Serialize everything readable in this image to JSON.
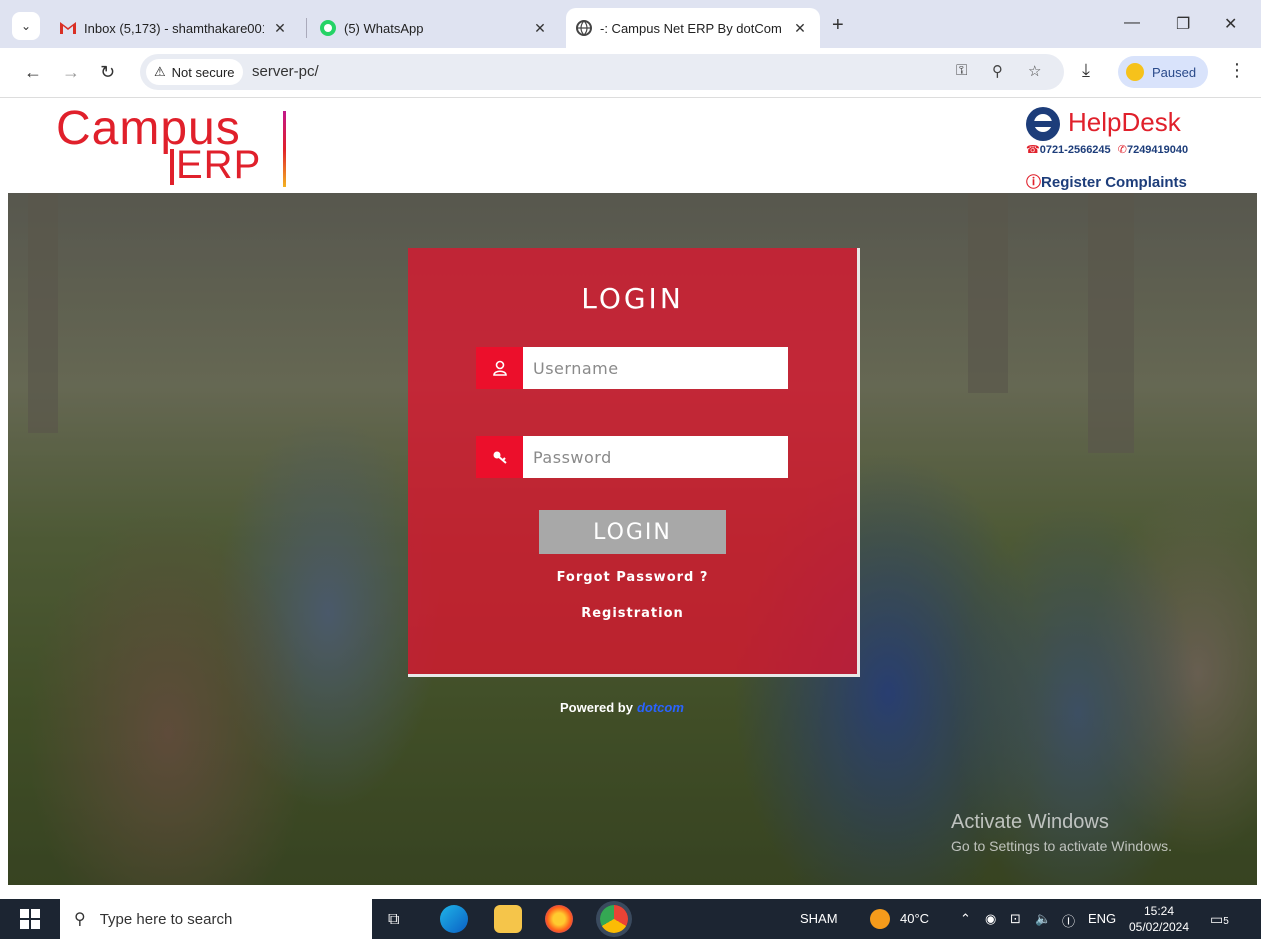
{
  "browser": {
    "tabs": [
      {
        "title": "Inbox (5,173) - shamthakare001",
        "icon": "gmail-icon"
      },
      {
        "title": "(5) WhatsApp",
        "icon": "whatsapp-icon"
      },
      {
        "title": "-: Campus Net ERP By dotCom",
        "icon": "globe-icon"
      }
    ],
    "security_label": "Not secure",
    "url": "server-pc/",
    "profile_status": "Paused"
  },
  "site": {
    "logo_campus": "Campus",
    "logo_erp": "ERP",
    "helpdesk": {
      "title": "HelpDesk",
      "phone1": "0721-2566245",
      "phone2": "7249419040",
      "register": "Register Complaints"
    }
  },
  "login": {
    "title": "LOGIN",
    "username_placeholder": "Username",
    "password_placeholder": "Password",
    "button": "LOGIN",
    "forgot": "Forgot Password ?",
    "registration": "Registration"
  },
  "footer": {
    "powered_by": "Powered by",
    "brand": "dotcom"
  },
  "watermark": {
    "line1": "Activate Windows",
    "line2": "Go to Settings to activate Windows."
  },
  "taskbar": {
    "search_placeholder": "Type here to search",
    "user": "SHAM",
    "weather": "40°C",
    "language": "ENG",
    "time": "15:24",
    "date": "05/02/2024",
    "notifications": "5"
  },
  "colors": {
    "brand_red": "#e0202b",
    "navy": "#1d3d7a",
    "panel": "#dd162f"
  }
}
